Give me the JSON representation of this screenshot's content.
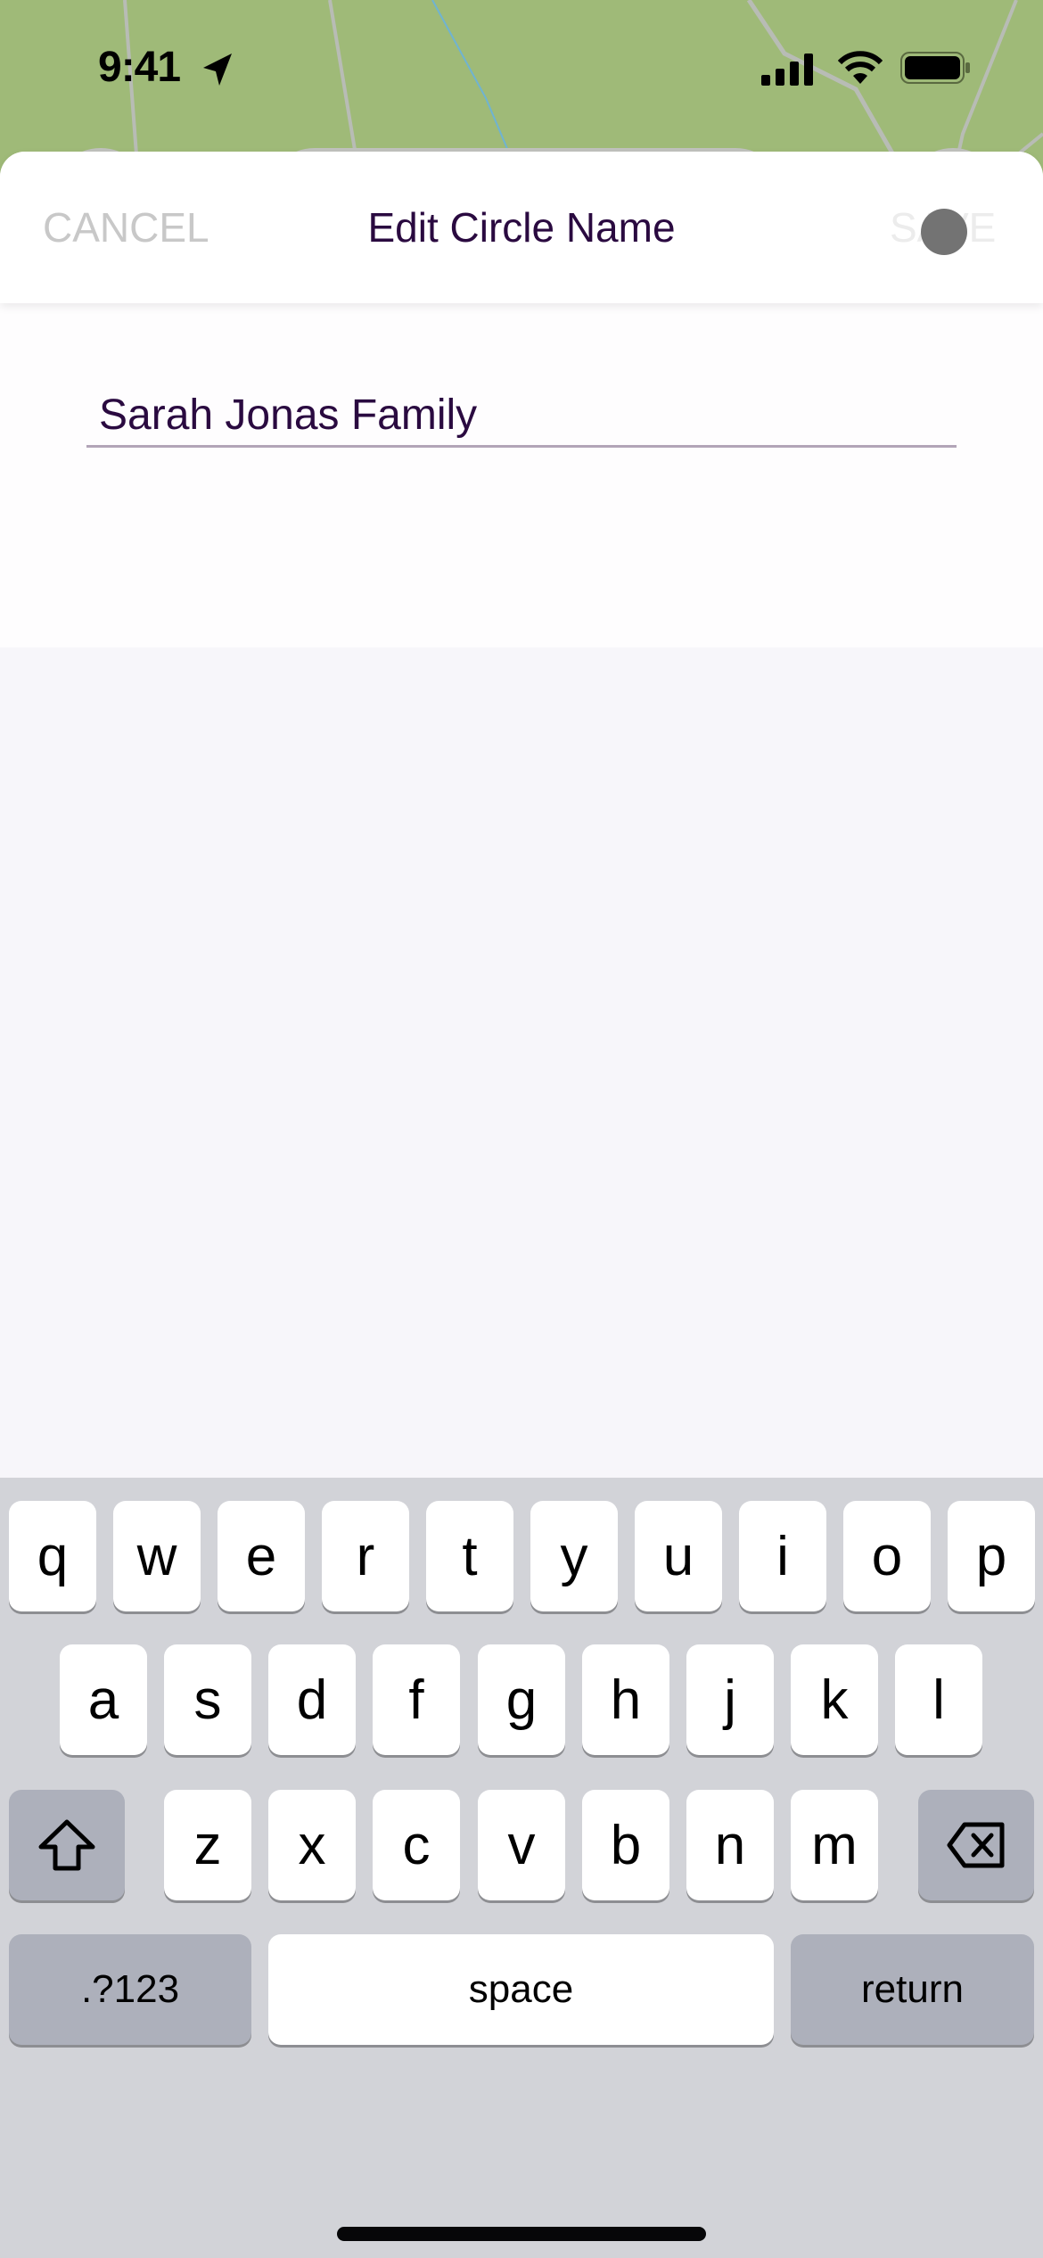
{
  "status_bar": {
    "time": "9:41",
    "icons": [
      "location-arrow-icon",
      "signal-icon",
      "wifi-icon",
      "battery-icon"
    ]
  },
  "nav": {
    "cancel_label": "CANCEL",
    "title": "Edit Circle Name",
    "save_label": "SAVE"
  },
  "form": {
    "circle_name_value": "Sarah Jonas Family"
  },
  "keyboard": {
    "row1": [
      "q",
      "w",
      "e",
      "r",
      "t",
      "y",
      "u",
      "i",
      "o",
      "p"
    ],
    "row2": [
      "a",
      "s",
      "d",
      "f",
      "g",
      "h",
      "j",
      "k",
      "l"
    ],
    "row3": [
      "z",
      "x",
      "c",
      "v",
      "b",
      "n",
      "m"
    ],
    "numbers_label": ".?123",
    "space_label": "space",
    "return_label": "return",
    "shift_icon": "shift-icon",
    "delete_icon": "delete-icon"
  },
  "colors": {
    "title": "#2a0a40",
    "cancel": "#c8c8c8",
    "save_disabled": "#ececec",
    "map_green": "#9fba78",
    "keyboard_bg": "#d2d3d8"
  }
}
